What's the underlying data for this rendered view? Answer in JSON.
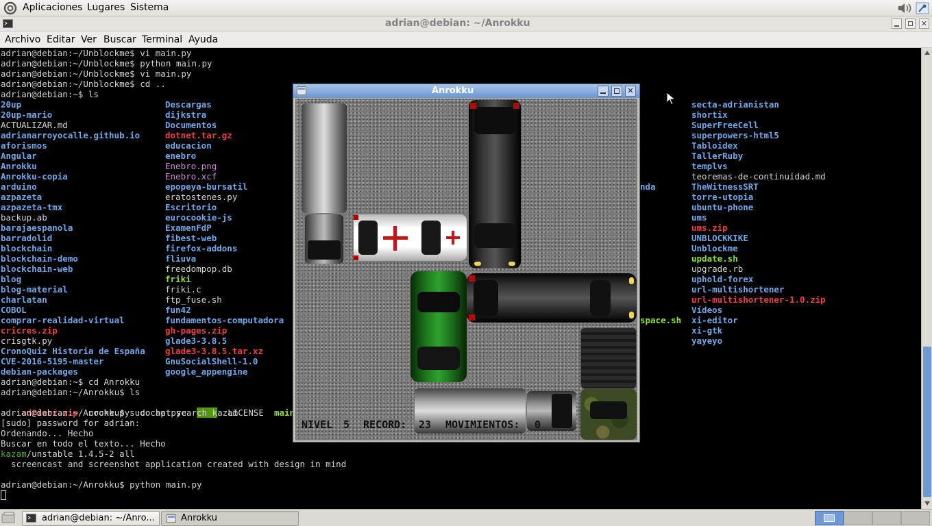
{
  "top_panel": {
    "menus": [
      "Aplicaciones",
      "Lugares",
      "Sistema"
    ]
  },
  "terminal_window": {
    "title": "adrian@debian: ~/Anrokku",
    "menu": [
      "Archivo",
      "Editar",
      "Ver",
      "Buscar",
      "Terminal",
      "Ayuda"
    ]
  },
  "terminal": {
    "pre_lines": [
      "adrian@debian:~/Unblockme$ vi main.py",
      "adrian@debian:~/Unblockme$ python main.py",
      "adrian@debian:~/Unblockme$ vi main.py",
      "adrian@debian:~/Unblockme$ cd ..",
      "adrian@debian:~$ ls"
    ],
    "ls_col1": [
      [
        "20up",
        "d"
      ],
      [
        "20up-mario",
        "d"
      ],
      [
        "ACTUALIZAR.md",
        "w"
      ],
      [
        "adrianarroyocalle.github.io",
        "d"
      ],
      [
        "aforismos",
        "d"
      ],
      [
        "Angular",
        "d"
      ],
      [
        "Anrokku",
        "d"
      ],
      [
        "Anrokku-copia",
        "d"
      ],
      [
        "arduino",
        "d"
      ],
      [
        "azpazeta",
        "d"
      ],
      [
        "azpazeta-tmx",
        "d"
      ],
      [
        "backup.ab",
        "w"
      ],
      [
        "barajaespanola",
        "d"
      ],
      [
        "barradolid",
        "d"
      ],
      [
        "blockchain",
        "d"
      ],
      [
        "blockchain-demo",
        "d"
      ],
      [
        "blockchain-web",
        "d"
      ],
      [
        "blog",
        "d"
      ],
      [
        "blog-material",
        "d"
      ],
      [
        "charlatan",
        "d"
      ],
      [
        "COBOL",
        "d"
      ],
      [
        "comprar-realidad-virtual",
        "d"
      ],
      [
        "cricres.zip",
        "r"
      ],
      [
        "crisgtk.py",
        "w"
      ],
      [
        "CronoQuiz Historia de España",
        "d"
      ],
      [
        "CVE-2016-5195-master",
        "d"
      ],
      [
        "debian-packages",
        "d"
      ]
    ],
    "ls_col2": [
      [
        "Descargas",
        "d"
      ],
      [
        "dijkstra",
        "d"
      ],
      [
        "Documentos",
        "d"
      ],
      [
        "dotnet.tar.gz",
        "r"
      ],
      [
        "educacion",
        "d"
      ],
      [
        "enebro",
        "d"
      ],
      [
        "Enebro.png",
        "m"
      ],
      [
        "Enebro.xcf",
        "m"
      ],
      [
        "epopeya-bursatil",
        "d"
      ],
      [
        "eratostenes.py",
        "w"
      ],
      [
        "Escritorio",
        "d"
      ],
      [
        "eurocookie-js",
        "d"
      ],
      [
        "ExamenFdP",
        "d"
      ],
      [
        "fibest-web",
        "d"
      ],
      [
        "firefox-addons",
        "d"
      ],
      [
        "fliuva",
        "d"
      ],
      [
        "freedompop.db",
        "w"
      ],
      [
        "friki",
        "g"
      ],
      [
        "friki.c",
        "w"
      ],
      [
        "ftp_fuse.sh",
        "w"
      ],
      [
        "fun42",
        "d"
      ],
      [
        "fundamentos-computadora",
        "d"
      ],
      [
        "gh-pages.zip",
        "r"
      ],
      [
        "glade3-3.8.5",
        "d"
      ],
      [
        "glade3-3.8.5.tar.xz",
        "r"
      ],
      [
        "GnuSocialShell-1.0",
        "d"
      ],
      [
        "google_appengine",
        "d"
      ]
    ],
    "ls_col4": [
      [
        "secta-adrianistan",
        "d"
      ],
      [
        "shortix",
        "d"
      ],
      [
        "SuperFreeCell",
        "d"
      ],
      [
        "superpowers-html5",
        "d"
      ],
      [
        "Tabloidex",
        "d"
      ],
      [
        "TallerRuby",
        "d"
      ],
      [
        "templvs",
        "d"
      ],
      [
        "teoremas-de-continuidad.md",
        "w"
      ],
      [
        "TheWitnessSRT",
        "d"
      ],
      [
        "torre-utopia",
        "d"
      ],
      [
        "ubuntu-phone",
        "d"
      ],
      [
        "ums",
        "d"
      ],
      [
        "ums.zip",
        "r"
      ],
      [
        "UNBLOCKKIKE",
        "d"
      ],
      [
        "Unblockme",
        "d"
      ],
      [
        "update.sh",
        "g"
      ],
      [
        "upgrade.rb",
        "w"
      ],
      [
        "uphold-forex",
        "d"
      ],
      [
        "url-multishortener",
        "d"
      ],
      [
        "url-multishortener-1.0.zip",
        "r"
      ],
      [
        "Vídeos",
        "d"
      ],
      [
        "xi-editor",
        "d"
      ],
      [
        "xi-gtk",
        "d"
      ],
      [
        "yayeyo",
        "d"
      ]
    ],
    "partial_col3": [
      {
        "row": 8,
        "text": "nda",
        "cls": "d"
      },
      {
        "row": 21,
        "text": "space.sh",
        "cls": "g"
      }
    ],
    "cd_line": "adrian@debian:~$ cd Anrokku",
    "ls_line2": "adrian@debian:~/Anrokku$ ls",
    "ls_anrokku": [
      [
        "adriarr.zip",
        "r"
      ],
      [
        "coche.py",
        "w"
      ],
      [
        "coche.pyc",
        "w"
      ],
      [
        "data",
        "hl"
      ],
      [
        "LICENSE",
        "w"
      ],
      [
        "main",
        "g"
      ]
    ],
    "post_lines": [
      [
        "adrian@debian:~/Anrokku$ sudo apt search kazam",
        "w"
      ],
      [
        "[sudo] password for adrian: ",
        "w"
      ],
      [
        "Ordenando... Hecho",
        "w"
      ],
      [
        "Buscar en todo el texto... Hecho",
        "w"
      ]
    ],
    "kazam_pkg": "kazam",
    "kazam_rest": "/unstable 1.4.5-2 all",
    "kazam_desc": "  screencast and screenshot application created with design in mind",
    "final_prompt": "adrian@debian:~/Anrokku$ python main.py"
  },
  "game_window": {
    "title": "Anrokku",
    "hud": {
      "nivel_label": "NIVEL",
      "nivel": "5",
      "record_label": "RECORD:",
      "record": "23",
      "mov_label": "MOVIMIENTOS:",
      "mov": "0"
    }
  },
  "taskbar": {
    "items": [
      "adrian@debian: ~/Anro...",
      "Anrokku"
    ]
  },
  "colors": {
    "dir": "#6fa8e8",
    "archive": "#ef4040",
    "exec": "#8ae234",
    "image": "#c98ad6",
    "titlebar": "#6b95d2"
  }
}
